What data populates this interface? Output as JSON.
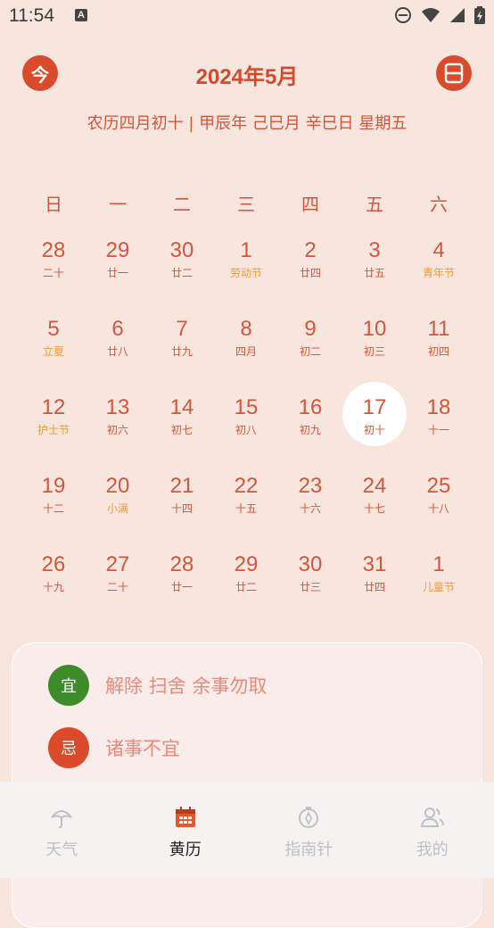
{
  "status_bar": {
    "time": "11:54",
    "a_icon": "A"
  },
  "header": {
    "today_button": "今",
    "title": "2024年5月",
    "lunar_info": "农历四月初十 | 甲辰年  己巳月  辛巳日  星期五"
  },
  "weekdays": [
    "日",
    "一",
    "二",
    "三",
    "四",
    "五",
    "六"
  ],
  "days": [
    {
      "d": "28",
      "s": "二十",
      "f": false
    },
    {
      "d": "29",
      "s": "廿一",
      "f": false
    },
    {
      "d": "30",
      "s": "廿二",
      "f": false
    },
    {
      "d": "1",
      "s": "劳动节",
      "f": true
    },
    {
      "d": "2",
      "s": "廿四",
      "f": false
    },
    {
      "d": "3",
      "s": "廿五",
      "f": false
    },
    {
      "d": "4",
      "s": "青年节",
      "f": true
    },
    {
      "d": "5",
      "s": "立夏",
      "f": true
    },
    {
      "d": "6",
      "s": "廿八",
      "f": false
    },
    {
      "d": "7",
      "s": "廿九",
      "f": false
    },
    {
      "d": "8",
      "s": "四月",
      "f": false
    },
    {
      "d": "9",
      "s": "初二",
      "f": false
    },
    {
      "d": "10",
      "s": "初三",
      "f": false
    },
    {
      "d": "11",
      "s": "初四",
      "f": false
    },
    {
      "d": "12",
      "s": "护士节",
      "f": true
    },
    {
      "d": "13",
      "s": "初六",
      "f": false
    },
    {
      "d": "14",
      "s": "初七",
      "f": false
    },
    {
      "d": "15",
      "s": "初八",
      "f": false
    },
    {
      "d": "16",
      "s": "初九",
      "f": false
    },
    {
      "d": "17",
      "s": "初十",
      "f": false,
      "sel": true
    },
    {
      "d": "18",
      "s": "十一",
      "f": false
    },
    {
      "d": "19",
      "s": "十二",
      "f": false
    },
    {
      "d": "20",
      "s": "小满",
      "f": true
    },
    {
      "d": "21",
      "s": "十四",
      "f": false
    },
    {
      "d": "22",
      "s": "十五",
      "f": false
    },
    {
      "d": "23",
      "s": "十六",
      "f": false
    },
    {
      "d": "24",
      "s": "十七",
      "f": false
    },
    {
      "d": "25",
      "s": "十八",
      "f": false
    },
    {
      "d": "26",
      "s": "十九",
      "f": false
    },
    {
      "d": "27",
      "s": "二十",
      "f": false
    },
    {
      "d": "28",
      "s": "廿一",
      "f": false
    },
    {
      "d": "29",
      "s": "廿二",
      "f": false
    },
    {
      "d": "30",
      "s": "廿三",
      "f": false
    },
    {
      "d": "31",
      "s": "廿四",
      "f": false
    },
    {
      "d": "1",
      "s": "儿童节",
      "f": true
    }
  ],
  "almanac": {
    "yi_badge": "宜",
    "yi_text": "解除 扫舍 余事勿取",
    "ji_badge": "忌",
    "ji_text": "诸事不宜"
  },
  "tabs": [
    {
      "label": "天气",
      "icon": "umbrella-icon"
    },
    {
      "label": "黄历",
      "icon": "calendar-icon"
    },
    {
      "label": "指南针",
      "icon": "compass-icon"
    },
    {
      "label": "我的",
      "icon": "user-icon"
    }
  ],
  "colors": {
    "accent": "#da4b2c",
    "festival": "#f09a3c",
    "yi_green": "#3d8b2a",
    "ji_red": "#da4b2c",
    "background": "#f8e6de"
  }
}
